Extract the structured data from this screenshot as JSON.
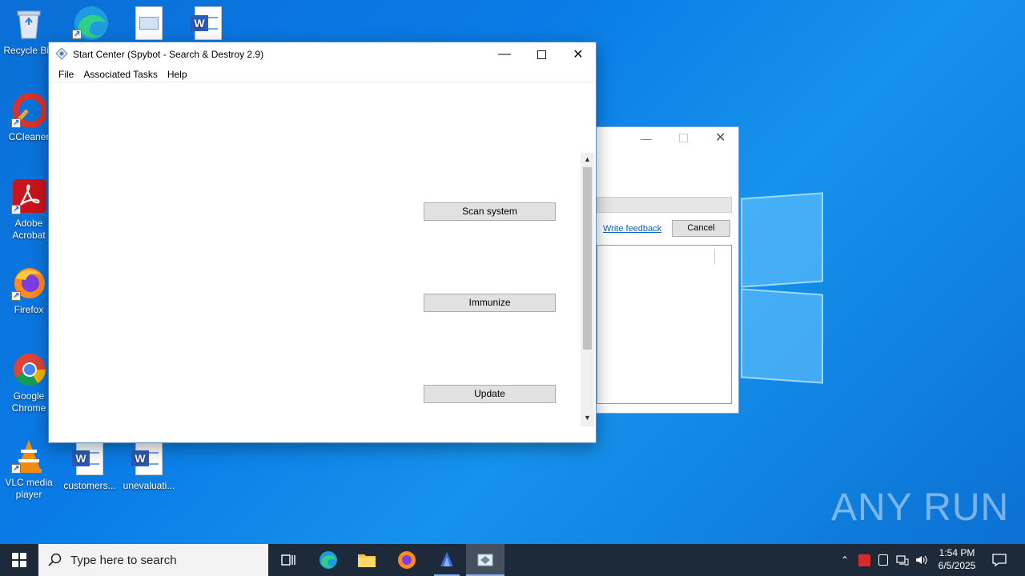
{
  "desktop": {
    "icons": [
      {
        "label": "Recycle Bin"
      },
      {
        "label": "CCleaner"
      },
      {
        "label": "Adobe Acrobat"
      },
      {
        "label": "Firefox"
      },
      {
        "label": "Google Chrome"
      },
      {
        "label": "VLC media player"
      },
      {
        "label": "customers..."
      },
      {
        "label": "unevaluati..."
      }
    ]
  },
  "main_window": {
    "title": "Start Center (Spybot - Search & Destroy 2.9)",
    "menu": [
      "File",
      "Associated Tasks",
      "Help"
    ],
    "buttons": {
      "scan": "Scan system",
      "immunize": "Immunize",
      "update": "Update"
    }
  },
  "back_window": {
    "write_feedback": "Write feedback",
    "cancel": "Cancel"
  },
  "taskbar": {
    "search_placeholder": "Type here to search",
    "time": "1:54 PM",
    "date": "6/5/2025"
  },
  "watermark": "ANY RUN",
  "colors": {
    "desktop_blue": "#0a7be6",
    "taskbar": "#1c2a3a",
    "button_bg": "#e1e1e1",
    "link": "#0b5fb8"
  }
}
